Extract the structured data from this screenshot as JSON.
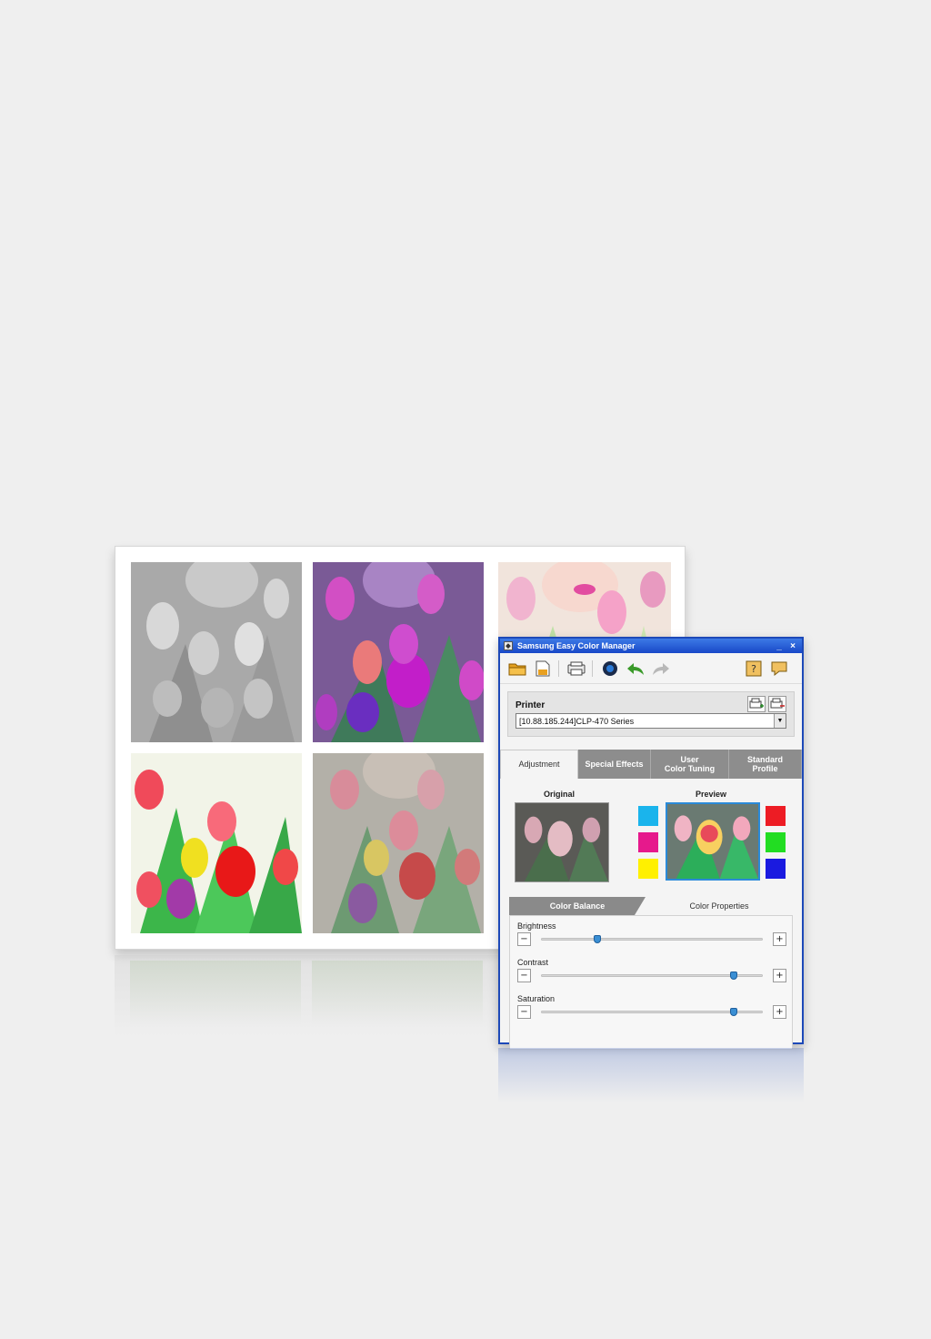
{
  "window": {
    "title": "Samsung Easy Color Manager",
    "controls": {
      "minimize": "_",
      "close": "×"
    }
  },
  "toolbar": {
    "buttons": [
      "open-icon",
      "save-icon",
      "printer-icon",
      "color-icon",
      "undo-icon",
      "redo-icon",
      "help-icon",
      "chat-icon"
    ]
  },
  "printer": {
    "label": "Printer",
    "selected": "[10.88.185.244]CLP-470 Series"
  },
  "tabs": [
    {
      "label": "Adjustment",
      "active": true
    },
    {
      "label": "Special Effects",
      "active": false
    },
    {
      "label": "User\nColor Tuning",
      "active": false
    },
    {
      "label": "Standard\nProfile",
      "active": false
    }
  ],
  "preview": {
    "original_label": "Original",
    "preview_label": "Preview",
    "cmy_swatches": [
      "#1ab4ec",
      "#e6198c",
      "#fff000"
    ],
    "rgb_swatches": [
      "#ed1c24",
      "#22dd22",
      "#1a1ae0"
    ]
  },
  "subtabs": {
    "color_balance": "Color Balance",
    "color_properties": "Color Properties"
  },
  "sliders": [
    {
      "label": "Brightness",
      "value": 0.25
    },
    {
      "label": "Contrast",
      "value": 0.87
    },
    {
      "label": "Saturation",
      "value": 0.87
    }
  ],
  "colors": {
    "title_bar": "#1848c8",
    "window_border": "#1d49b8",
    "tab_inactive": "#8d8d8d",
    "slider_thumb": "#3a8fd4"
  }
}
